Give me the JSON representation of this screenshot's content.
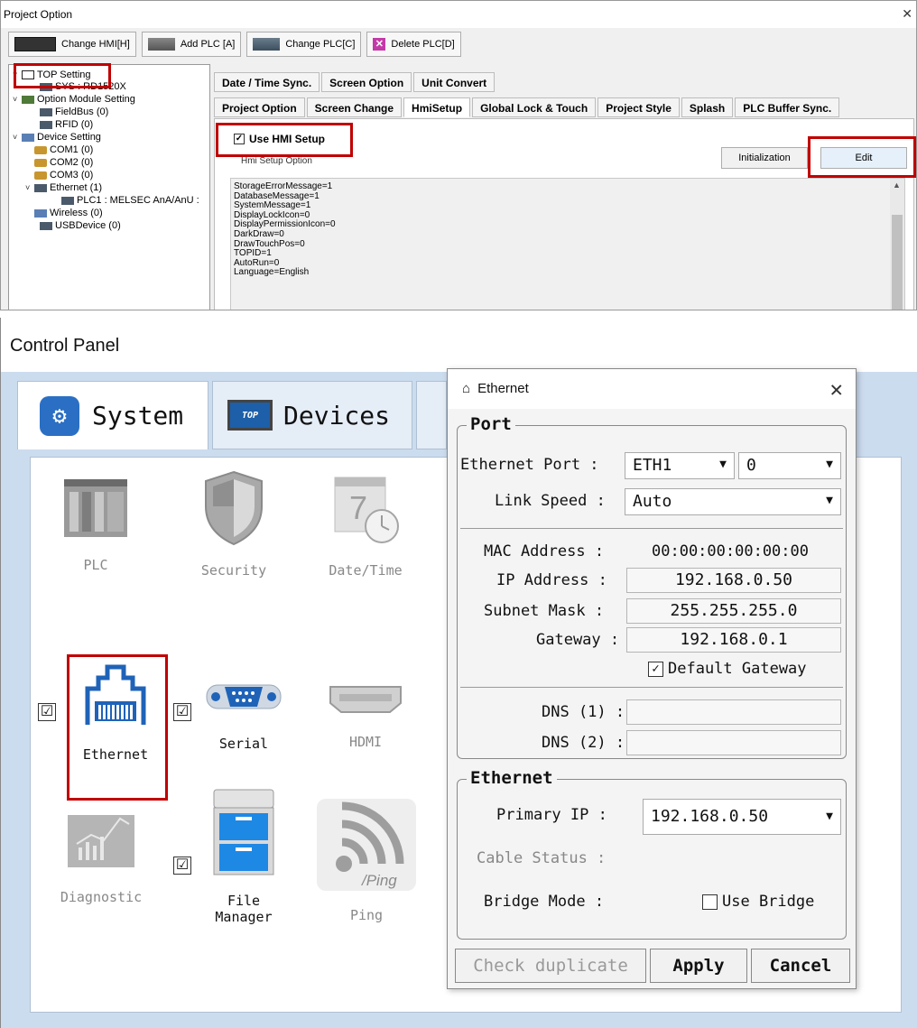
{
  "project": {
    "title": "Project Option",
    "toolbar": {
      "change_hmi": "Change HMI[H]",
      "add_plc": "Add PLC [A]",
      "change_plc": "Change PLC[C]",
      "delete_plc": "Delete PLC[D]"
    },
    "tree": {
      "top_setting": "TOP Setting",
      "sys": "SYS : RD1520X",
      "option_module": "Option Module Setting",
      "fieldbus": "FieldBus (0)",
      "rfid": "RFID (0)",
      "device_setting": "Device Setting",
      "com1": "COM1 (0)",
      "com2": "COM2 (0)",
      "com3": "COM3 (0)",
      "ethernet": "Ethernet (1)",
      "plc1": "PLC1 : MELSEC AnA/AnU :",
      "wireless": "Wireless (0)",
      "usbdevice": "USBDevice (0)"
    },
    "tabs_row1": [
      "Date / Time Sync.",
      "Screen Option",
      "Unit Convert"
    ],
    "tabs_row2": [
      "Project Option",
      "Screen Change",
      "HmiSetup",
      "Global Lock & Touch",
      "Project Style",
      "Splash",
      "PLC Buffer Sync."
    ],
    "active_tab": "HmiSetup",
    "use_hmi_setup": "Use HMI Setup",
    "hmi_setup_option": "Hmi Setup Option",
    "initialization": "Initialization",
    "edit": "Edit",
    "config_lines": [
      "StorageErrorMessage=1",
      "DatabaseMessage=1",
      "SystemMessage=1",
      "DisplayLockIcon=0",
      "DisplayPermissionIcon=0",
      "DarkDraw=0",
      "DrawTouchPos=0",
      "TOPID=1",
      "AutoRun=0",
      "Language=English"
    ]
  },
  "control_panel": {
    "title": "Control Panel",
    "tabs": {
      "system": "System",
      "devices": "Devices",
      "top_badge": "TOP"
    },
    "items": {
      "plc": "PLC",
      "security": "Security",
      "datetime": "Date/Time",
      "ethernet": "Ethernet",
      "serial": "Serial",
      "hdmi": "HDMI",
      "diagnostic": "Diagnostic",
      "file_manager_1": "File",
      "file_manager_2": "Manager",
      "ping": "Ping",
      "ping_overlay": "/Ping",
      "calendar_day": "7",
      "check_mark": "☑"
    }
  },
  "ethernet_dialog": {
    "title": "Ethernet",
    "port_legend": "Port",
    "ethernet_port_label": "Ethernet Port :",
    "ethernet_port_value": "ETH1",
    "ethernet_port_index": "0",
    "link_speed_label": "Link Speed :",
    "link_speed_value": "Auto",
    "mac_label": "MAC Address :",
    "mac_value": "00:00:00:00:00:00",
    "ip_label": "IP Address :",
    "ip_value": "192.168.0.50",
    "subnet_label": "Subnet Mask :",
    "subnet_value": "255.255.255.0",
    "gateway_label": "Gateway :",
    "gateway_value": "192.168.0.1",
    "default_gateway": "Default Gateway",
    "dns1_label": "DNS (1) :",
    "dns2_label": "DNS (2) :",
    "ethernet_legend": "Ethernet",
    "primary_ip_label": "Primary IP :",
    "primary_ip_value": "192.168.0.50",
    "cable_status_label": "Cable Status :",
    "bridge_mode_label": "Bridge Mode :",
    "use_bridge": "Use Bridge",
    "check_duplicate": "Check duplicate",
    "apply": "Apply",
    "cancel": "Cancel"
  },
  "colors": {
    "highlight": "#c00000",
    "panel_bg": "#ccdcef",
    "accent": "#2a6fc4"
  }
}
